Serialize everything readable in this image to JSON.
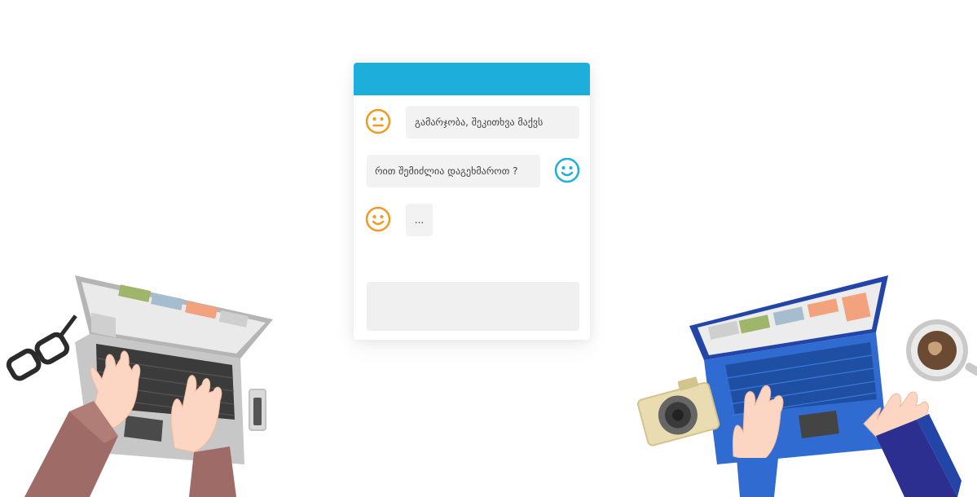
{
  "chat": {
    "messages": [
      {
        "sender": "visitor",
        "avatar_icon": "neutral-face-icon",
        "avatar_color": "#f29a1f",
        "text": "გამარჯობა, შეკითხვა მაქვს"
      },
      {
        "sender": "agent",
        "avatar_icon": "smiley-face-icon",
        "avatar_color": "#1eaedb",
        "text": "რით შემიძლია დაგეხმაროთ ?"
      },
      {
        "sender": "visitor",
        "avatar_icon": "smiley-face-icon",
        "avatar_color": "#f29a1f",
        "text": "..."
      }
    ],
    "input": {
      "value": ""
    }
  },
  "colors": {
    "header": "#1eaedb",
    "accent_orange": "#f29a1f",
    "bubble_bg": "#f2f2f2"
  }
}
